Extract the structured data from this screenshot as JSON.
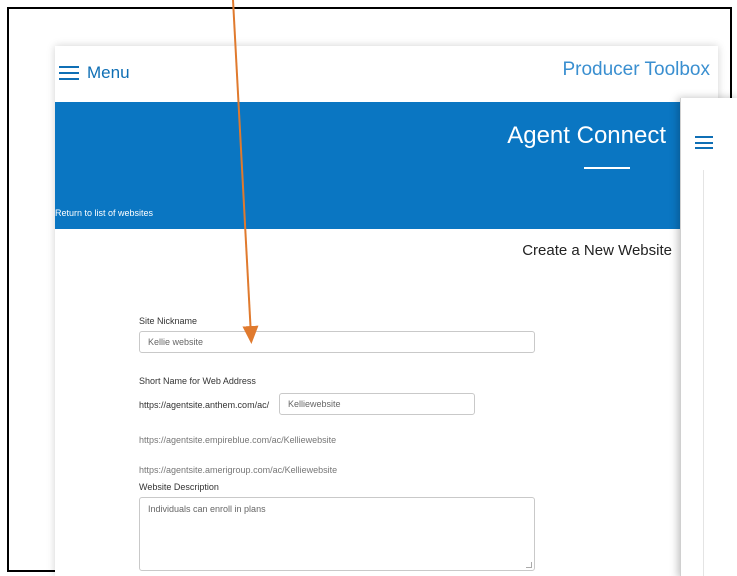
{
  "topbar": {
    "menu_label": "Menu",
    "brand": "Producer Toolbox"
  },
  "banner": {
    "title": "Agent Connect",
    "return_link": "Return to list of websites"
  },
  "page": {
    "heading": "Create a New Website"
  },
  "form": {
    "nickname_label": "Site Nickname",
    "nickname_value": "Kellie website",
    "shortname_label": "Short Name for Web Address",
    "url_prefix": "https://agentsite.anthem.com/ac/",
    "shortname_value": "Kelliewebsite",
    "url_empireblue": "https://agentsite.empireblue.com/ac/Kelliewebsite",
    "url_amerigroup": "https://agentsite.amerigroup.com/ac/Kelliewebsite",
    "description_label": "Website Description",
    "description_value": "Individuals can enroll in plans"
  },
  "colors": {
    "accent": "#0a76c2",
    "arrow": "#e07a2e"
  }
}
